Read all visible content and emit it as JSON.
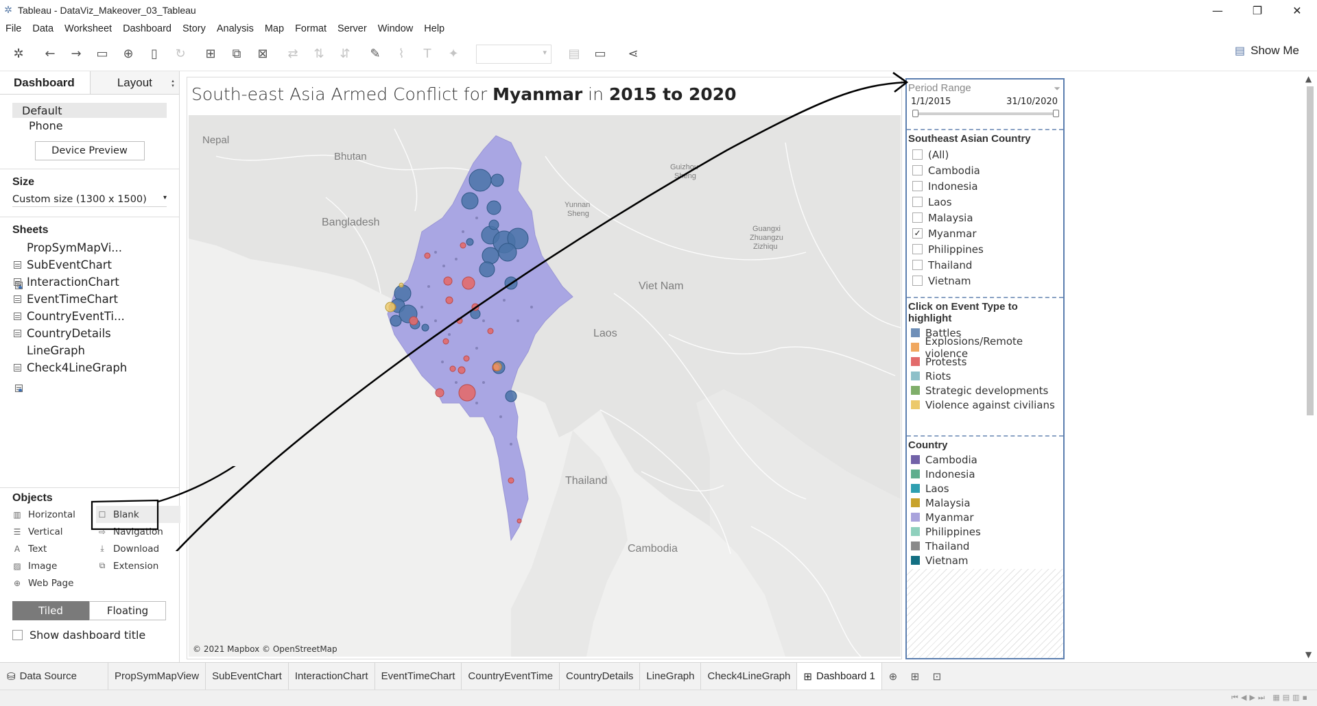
{
  "window": {
    "title": "Tableau - DataViz_Makeover_03_Tableau"
  },
  "menu": [
    "File",
    "Data",
    "Worksheet",
    "Dashboard",
    "Story",
    "Analysis",
    "Map",
    "Format",
    "Server",
    "Window",
    "Help"
  ],
  "toolbar": {
    "show_me": "Show Me"
  },
  "left": {
    "tabs": {
      "dashboard": "Dashboard",
      "layout": "Layout"
    },
    "devices": {
      "default": "Default",
      "phone": "Phone",
      "preview_button": "Device Preview"
    },
    "size": {
      "heading": "Size",
      "value": "Custom size (1300 x 1500)"
    },
    "sheets": {
      "heading": "Sheets",
      "items": [
        "PropSymMapVi...",
        "SubEventChart",
        "InteractionChart",
        "EventTimeChart",
        "CountryEventTi...",
        "CountryDetails",
        "LineGraph",
        "Check4LineGraph"
      ]
    },
    "objects": {
      "heading": "Objects",
      "items": [
        "Horizontal",
        "Blank",
        "Vertical",
        "Navigation",
        "Text",
        "Download",
        "Image",
        "Extension",
        "Web Page"
      ]
    },
    "mode": {
      "tiled": "Tiled",
      "floating": "Floating"
    },
    "show_title": "Show dashboard title"
  },
  "dashboard": {
    "title_pre": "South-east Asia Armed Conflict for ",
    "title_country": "Myanmar",
    "title_mid": " in ",
    "title_years": "2015 to 2020",
    "map_credit": "© 2021 Mapbox © OpenStreetMap",
    "map_labels": [
      "Nepal",
      "Bhutan",
      "Bangladesh",
      "Yunnan",
      "Sheng",
      "Guizhou",
      "Sheng",
      "Guangxi",
      "Zhuangzu",
      "Zizhiqu",
      "Viet Nam",
      "Laos",
      "Thailand",
      "Cambodia"
    ]
  },
  "filters": {
    "period": {
      "heading": "Period Range",
      "start": "1/1/2015",
      "end": "31/10/2020",
      "start_frac": 0,
      "end_frac": 1
    },
    "country_filter": {
      "heading": "Southeast Asian Country",
      "options": [
        {
          "label": "(All)",
          "checked": false
        },
        {
          "label": "Cambodia",
          "checked": false
        },
        {
          "label": "Indonesia",
          "checked": false
        },
        {
          "label": "Laos",
          "checked": false
        },
        {
          "label": "Malaysia",
          "checked": false
        },
        {
          "label": "Myanmar",
          "checked": true
        },
        {
          "label": "Philippines",
          "checked": false
        },
        {
          "label": "Thailand",
          "checked": false
        },
        {
          "label": "Vietnam",
          "checked": false
        }
      ]
    },
    "event_legend": {
      "heading": "Click on Event Type to highlight",
      "items": [
        {
          "label": "Battles",
          "color": "#6f8fb8"
        },
        {
          "label": "Explosions/Remote violence",
          "color": "#f0a860"
        },
        {
          "label": "Protests",
          "color": "#e26b6b"
        },
        {
          "label": "Riots",
          "color": "#8ec0c9"
        },
        {
          "label": "Strategic developments",
          "color": "#7fae6a"
        },
        {
          "label": "Violence against civilians",
          "color": "#ecc96a"
        }
      ]
    },
    "country_legend": {
      "heading": "Country",
      "items": [
        {
          "label": "Cambodia",
          "color": "#7262a8"
        },
        {
          "label": "Indonesia",
          "color": "#5fae8e"
        },
        {
          "label": "Laos",
          "color": "#2f9fb0"
        },
        {
          "label": "Malaysia",
          "color": "#c8a32c"
        },
        {
          "label": "Myanmar",
          "color": "#a9a3dc"
        },
        {
          "label": "Philippines",
          "color": "#8fd0bd"
        },
        {
          "label": "Thailand",
          "color": "#8a8a8a"
        },
        {
          "label": "Vietnam",
          "color": "#136f82"
        }
      ]
    }
  },
  "bottom_tabs": {
    "data_source": "Data Source",
    "sheets": [
      "PropSymMapView",
      "SubEventChart",
      "InteractionChart",
      "EventTimeChart",
      "CountryEventTime",
      "CountryDetails",
      "LineGraph",
      "Check4LineGraph"
    ],
    "active": "Dashboard 1"
  },
  "colors": {
    "battles": "#4a73a8",
    "protests": "#d9534f",
    "myanmar_fill": "#a9a6e3",
    "accent": "#5b7eaf"
  }
}
